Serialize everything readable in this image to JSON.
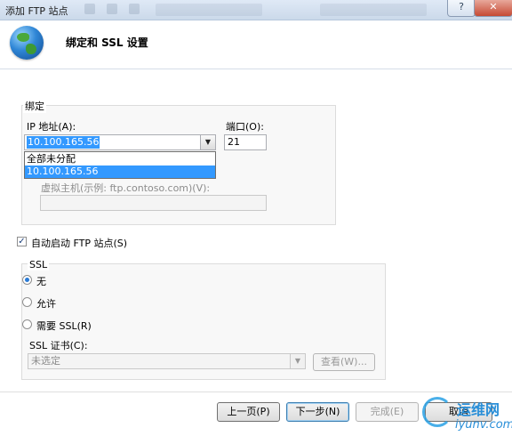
{
  "window": {
    "title": "添加 FTP 站点",
    "help_label": "?",
    "close_label": "✕"
  },
  "header": {
    "title": "绑定和 SSL 设置",
    "icon": "globe-icon"
  },
  "binding": {
    "group_label": "绑定",
    "ip_label": "IP 地址(A):",
    "ip_value": "10.100.165.56",
    "port_label": "端口(O):",
    "port_value": "21",
    "dropdown_options": [
      "全部未分配",
      "10.100.165.56"
    ],
    "selected_option_index": 1,
    "virtual_host_label": "虚拟主机(示例: ftp.contoso.com)(V):",
    "virtual_host_value": ""
  },
  "auto_start": {
    "label": "自动启动 FTP 站点(S)",
    "checked": true
  },
  "ssl": {
    "group_label": "SSL",
    "options": [
      {
        "label": "无",
        "selected": true
      },
      {
        "label": "允许",
        "selected": false
      },
      {
        "label": "需要 SSL(R)",
        "selected": false
      }
    ],
    "cert_label": "SSL 证书(C):",
    "cert_value": "未选定",
    "view_button": "查看(W)..."
  },
  "footer": {
    "prev_button": "上一页(P)",
    "next_button": "下一步(N)",
    "finish_button": "完成(E)",
    "cancel_button": "取消"
  },
  "watermark": {
    "line1": "运维网",
    "line2": "iyunv.com"
  }
}
